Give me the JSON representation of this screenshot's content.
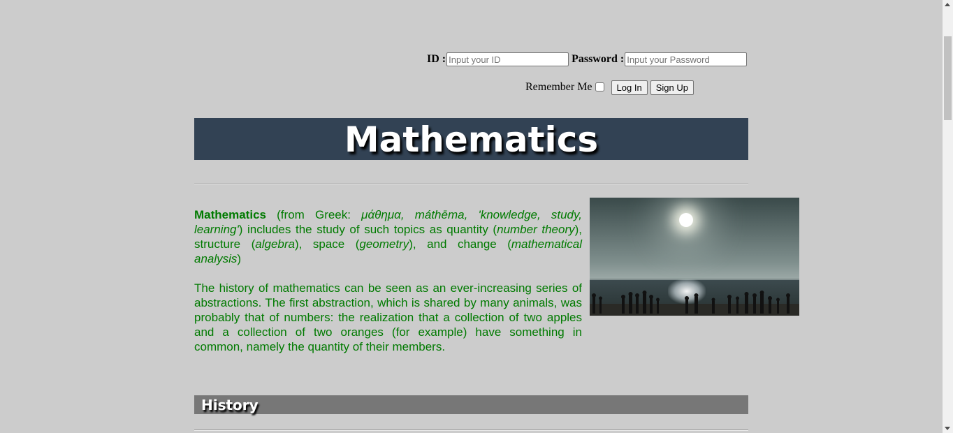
{
  "login": {
    "id_label": "ID :",
    "id_placeholder": "Input your ID",
    "password_label": "Password :",
    "password_placeholder": "Input your Password",
    "remember_label": "Remember Me",
    "login_button": "Log In",
    "signup_button": "Sign Up"
  },
  "banner": {
    "title": "Mathematics"
  },
  "intro": {
    "term": "Mathematics",
    "p1_a": " (from Greek: ",
    "p1_greek": "μάθημα, máthēma, 'knowledge, study, learning'",
    "p1_b": ") includes the study of such topics as quantity (",
    "p1_number_theory": "number theory",
    "p1_c": "), structure (",
    "p1_algebra": "algebra",
    "p1_d": "), space (",
    "p1_geometry": "geometry",
    "p1_e": "), and change (",
    "p1_analysis": "mathematical analysis",
    "p1_f": ")",
    "p2": "The history of mathematics can be seen as an ever-increasing series of abstractions. The first abstraction, which is shared by many animals, was probably that of numbers: the realization that a collection of two apples and a collection of two oranges (for example) have something in common, namely the quantity of their members."
  },
  "sections": {
    "history": "History"
  },
  "colors": {
    "page_bg": "#cccccc",
    "banner_bg": "#324254",
    "section_bg": "#777777",
    "text_green": "#007a00"
  }
}
